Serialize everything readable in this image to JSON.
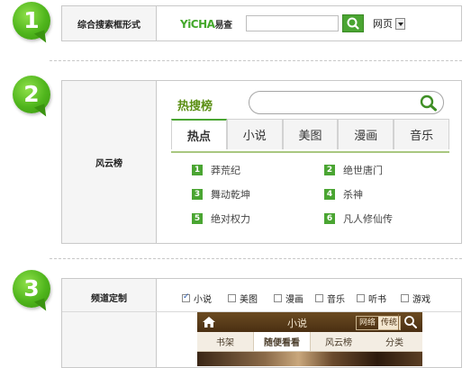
{
  "steps": [
    "1",
    "2",
    "3"
  ],
  "section1": {
    "label": "综合搜索框形式",
    "logo_en": "YiCHA",
    "logo_cn": "易查",
    "search_value": "",
    "select_value": "网页"
  },
  "section2": {
    "label": "风云榜",
    "title": "热搜榜",
    "search_value": "",
    "tabs": [
      "热点",
      "小说",
      "美图",
      "漫画",
      "音乐"
    ],
    "active_tab": "热点",
    "ranks": [
      {
        "num": "1",
        "text": "莽荒纪"
      },
      {
        "num": "2",
        "text": "绝世唐门"
      },
      {
        "num": "3",
        "text": "舞动乾坤"
      },
      {
        "num": "4",
        "text": "杀神"
      },
      {
        "num": "5",
        "text": "绝对权力"
      },
      {
        "num": "6",
        "text": "凡人修仙传"
      }
    ]
  },
  "section3": {
    "label": "频道定制",
    "channels": [
      {
        "name": "小说",
        "checked": true
      },
      {
        "name": "美图",
        "checked": false
      },
      {
        "name": "漫画",
        "checked": false
      },
      {
        "name": "音乐",
        "checked": false
      },
      {
        "name": "听书",
        "checked": false
      },
      {
        "name": "游戏",
        "checked": false
      }
    ],
    "preview": {
      "title": "小说",
      "toggle_web": "网络",
      "toggle_mobile": "传统",
      "nav": [
        "书架",
        "随便看看",
        "风云榜",
        "分类"
      ],
      "nav_current": "随便看看"
    }
  },
  "colors": {
    "accent": "#4aa532",
    "title_green": "#5b8f14",
    "preview_bar": "#5a3b1a"
  },
  "icons": [
    "search-icon",
    "home-icon",
    "dropdown-arrow-icon",
    "checkbox-icon"
  ]
}
